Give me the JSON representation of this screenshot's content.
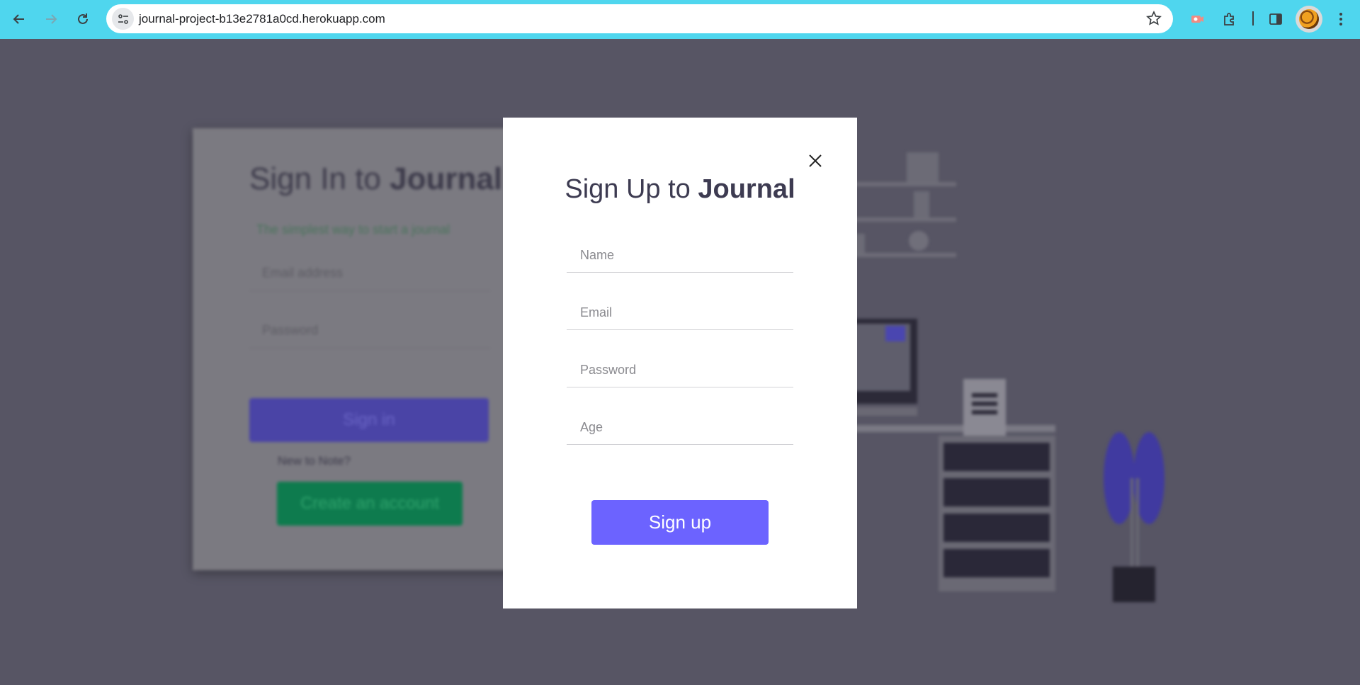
{
  "browser": {
    "url": "journal-project-b13e2781a0cd.herokuapp.com"
  },
  "background_page": {
    "title_prefix": "Sign In to",
    "title_brand": "Journal",
    "subtitle": "The simplest way to start a journal",
    "email_placeholder": "Email address",
    "password_placeholder": "Password",
    "signin_label": "Sign in",
    "new_to_text": "New to Note?",
    "create_account_label": "Create an account"
  },
  "modal": {
    "title_prefix": "Sign Up to",
    "title_brand": "Journal",
    "fields": {
      "name_placeholder": "Name",
      "email_placeholder": "Email",
      "password_placeholder": "Password",
      "age_placeholder": "Age"
    },
    "submit_label": "Sign up"
  },
  "colors": {
    "chrome": "#4fd6ee",
    "overlay": "#575564",
    "accent": "#6c63ff",
    "title_text": "#3d3b51"
  },
  "icons": [
    "back-arrow-icon",
    "forward-arrow-icon",
    "reload-icon",
    "site-settings-icon",
    "bookmark-star-icon",
    "extension-icon",
    "puzzle-icon",
    "side-panel-icon",
    "profile-avatar",
    "menu-dots-icon",
    "close-icon"
  ]
}
